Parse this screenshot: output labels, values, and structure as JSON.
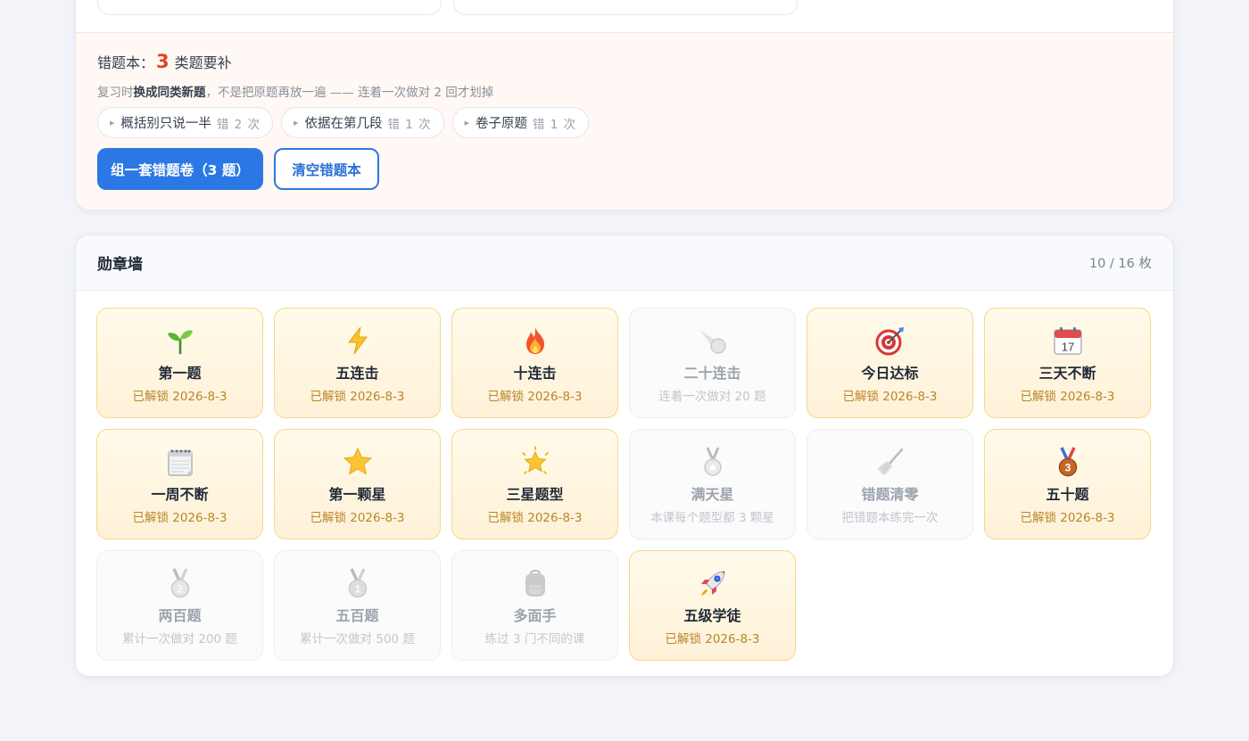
{
  "mistakes": {
    "title_prefix": "错题本：",
    "count": "3",
    "title_suffix": "类题要补",
    "desc_pre": "复习时",
    "desc_bold": "换成同类新题",
    "desc_post": "，不是把原题再放一遍 —— 连着一次做对 2 回才划掉",
    "chips": [
      {
        "label": "概括别只说一半",
        "count": "错 2 次"
      },
      {
        "label": "依据在第几段",
        "count": "错 1 次"
      },
      {
        "label": "卷子原题",
        "count": "错 1 次"
      }
    ],
    "primary_button": "组一套错题卷（3 题）",
    "clear_button": "清空错题本"
  },
  "badges": {
    "title": "勋章墙",
    "count": "10 / 16 枚",
    "items": [
      {
        "icon": "seedling-icon",
        "name": "第一题",
        "sub": "已解锁 2026-8-3",
        "unlocked": true
      },
      {
        "icon": "lightning-icon",
        "name": "五连击",
        "sub": "已解锁 2026-8-3",
        "unlocked": true
      },
      {
        "icon": "fire-icon",
        "name": "十连击",
        "sub": "已解锁 2026-8-3",
        "unlocked": true
      },
      {
        "icon": "comet-icon",
        "name": "二十连击",
        "sub": "连着一次做对 20 题",
        "unlocked": false
      },
      {
        "icon": "target-icon",
        "name": "今日达标",
        "sub": "已解锁 2026-8-3",
        "unlocked": true
      },
      {
        "icon": "calendar-icon",
        "name": "三天不断",
        "sub": "已解锁 2026-8-3",
        "unlocked": true,
        "calendar_text": "17"
      },
      {
        "icon": "spiral-calendar-icon",
        "name": "一周不断",
        "sub": "已解锁 2026-8-3",
        "unlocked": true
      },
      {
        "icon": "star-icon",
        "name": "第一颗星",
        "sub": "已解锁 2026-8-3",
        "unlocked": true
      },
      {
        "icon": "glowing-star-icon",
        "name": "三星题型",
        "sub": "已解锁 2026-8-3",
        "unlocked": true
      },
      {
        "icon": "medal-icon",
        "name": "满天星",
        "sub": "本课每个题型都 3 颗星",
        "unlocked": false
      },
      {
        "icon": "broom-icon",
        "name": "错题清零",
        "sub": "把错题本练完一次",
        "unlocked": false
      },
      {
        "icon": "bronze-medal-icon",
        "name": "五十题",
        "sub": "已解锁 2026-8-3",
        "unlocked": true,
        "medal_text": "3"
      },
      {
        "icon": "silver-medal-icon",
        "name": "两百题",
        "sub": "累计一次做对 200 题",
        "unlocked": false,
        "medal_text": "2"
      },
      {
        "icon": "gold-medal-icon",
        "name": "五百题",
        "sub": "累计一次做对 500 题",
        "unlocked": false,
        "medal_text": "1"
      },
      {
        "icon": "backpack-icon",
        "name": "多面手",
        "sub": "练过 3 门不同的课",
        "unlocked": false
      },
      {
        "icon": "rocket-icon",
        "name": "五级学徒",
        "sub": "已解锁 2026-8-3",
        "unlocked": true
      }
    ]
  }
}
